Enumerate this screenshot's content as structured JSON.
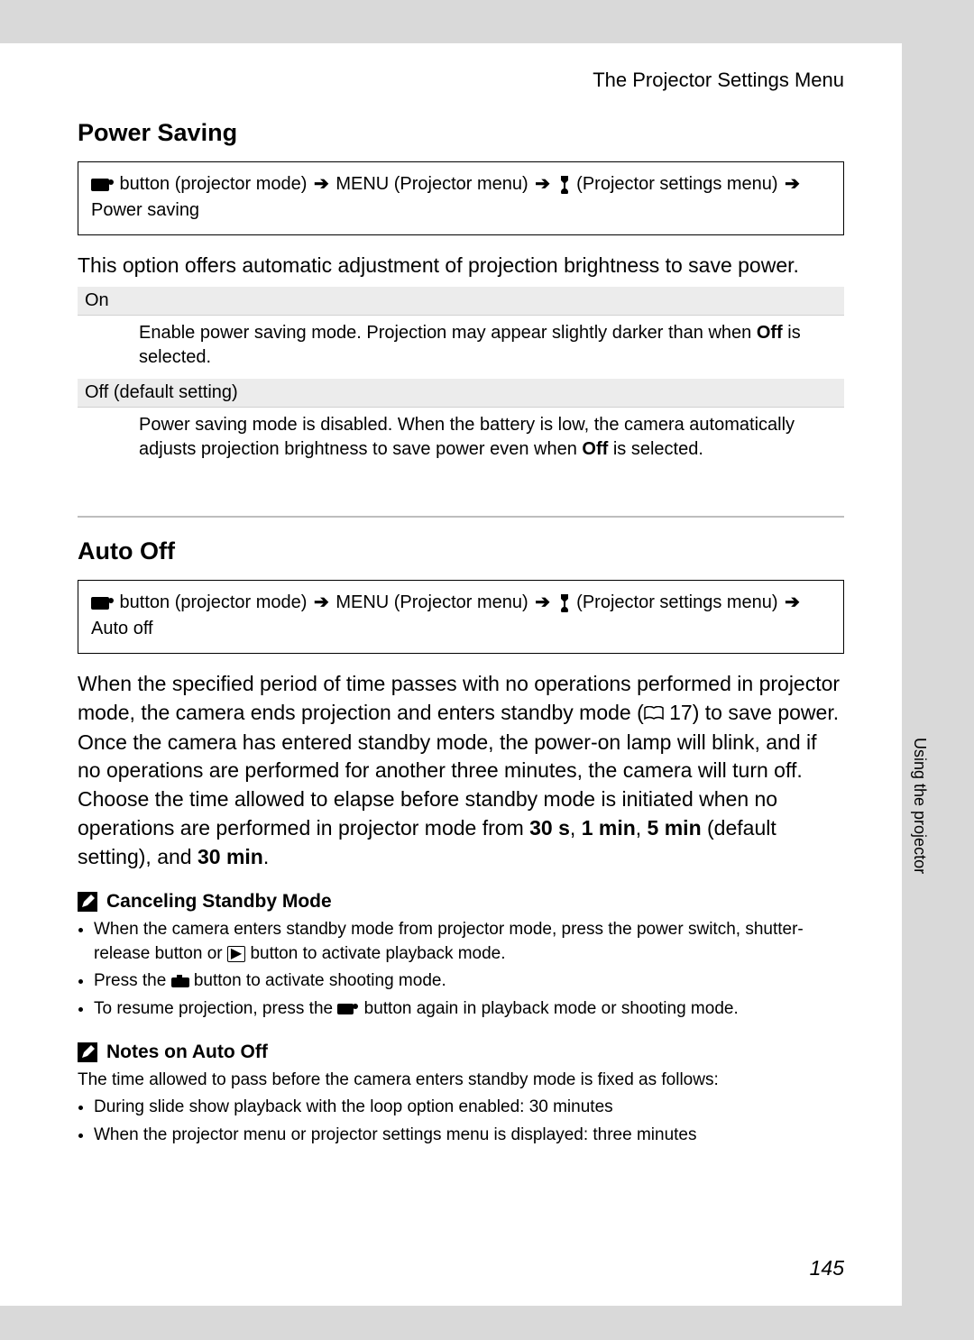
{
  "running_head": "The Projector Settings Menu",
  "side_label": "Using the projector",
  "page_number": "145",
  "power_saving": {
    "heading": "Power Saving",
    "path_tail": "Power saving",
    "intro": "This option offers automatic adjustment of projection brightness to save power.",
    "row1_label": "On",
    "row1_text_a": "Enable power saving mode. Projection may appear slightly darker than when ",
    "row1_bold": "Off",
    "row1_text_b": " is selected.",
    "row2_label": "Off (default setting)",
    "row2_text_a": "Power saving mode is disabled. When the battery is low, the camera automatically adjusts projection brightness to save power even when ",
    "row2_bold": "Off",
    "row2_text_b": " is selected."
  },
  "path_labels": {
    "btn_mode": " button (projector mode) ",
    "menu_word": "MENU",
    "proj_menu": " (Projector menu) ",
    "proj_settings": " (Projector settings menu) "
  },
  "auto_off": {
    "heading": "Auto Off",
    "path_tail": "Auto off",
    "para_a": "When the specified period of time passes with no operations performed in projector mode, the camera ends projection and enters standby mode (",
    "page_ref": " 17",
    "para_b": ") to save power. Once the camera has entered standby mode, the power-on lamp will blink, and if no operations are performed for another three minutes, the camera will turn off. Choose the time allowed to elapse before standby mode is initiated when no operations are performed in projector mode from ",
    "opt1": "30 s",
    "sep": ", ",
    "opt2": "1 min",
    "opt3": "5 min",
    "para_c": " (default setting), and ",
    "opt4": "30 min",
    "para_end": "."
  },
  "cancel_standby": {
    "heading": "Canceling Standby Mode",
    "b1_a": "When the camera enters standby mode from projector mode, press the power switch, shutter-release button or ",
    "b1_b": " button to activate playback mode.",
    "b2_a": "Press the ",
    "b2_b": " button to activate shooting mode.",
    "b3_a": "To resume projection, press the ",
    "b3_b": " button again in playback mode or shooting mode."
  },
  "notes_auto_off": {
    "heading": "Notes on Auto Off",
    "intro": "The time allowed to pass before the camera enters standby mode is fixed as follows:",
    "b1": "During slide show playback with the loop option enabled: 30 minutes",
    "b2": "When the projector menu or projector settings menu is displayed: three minutes"
  }
}
